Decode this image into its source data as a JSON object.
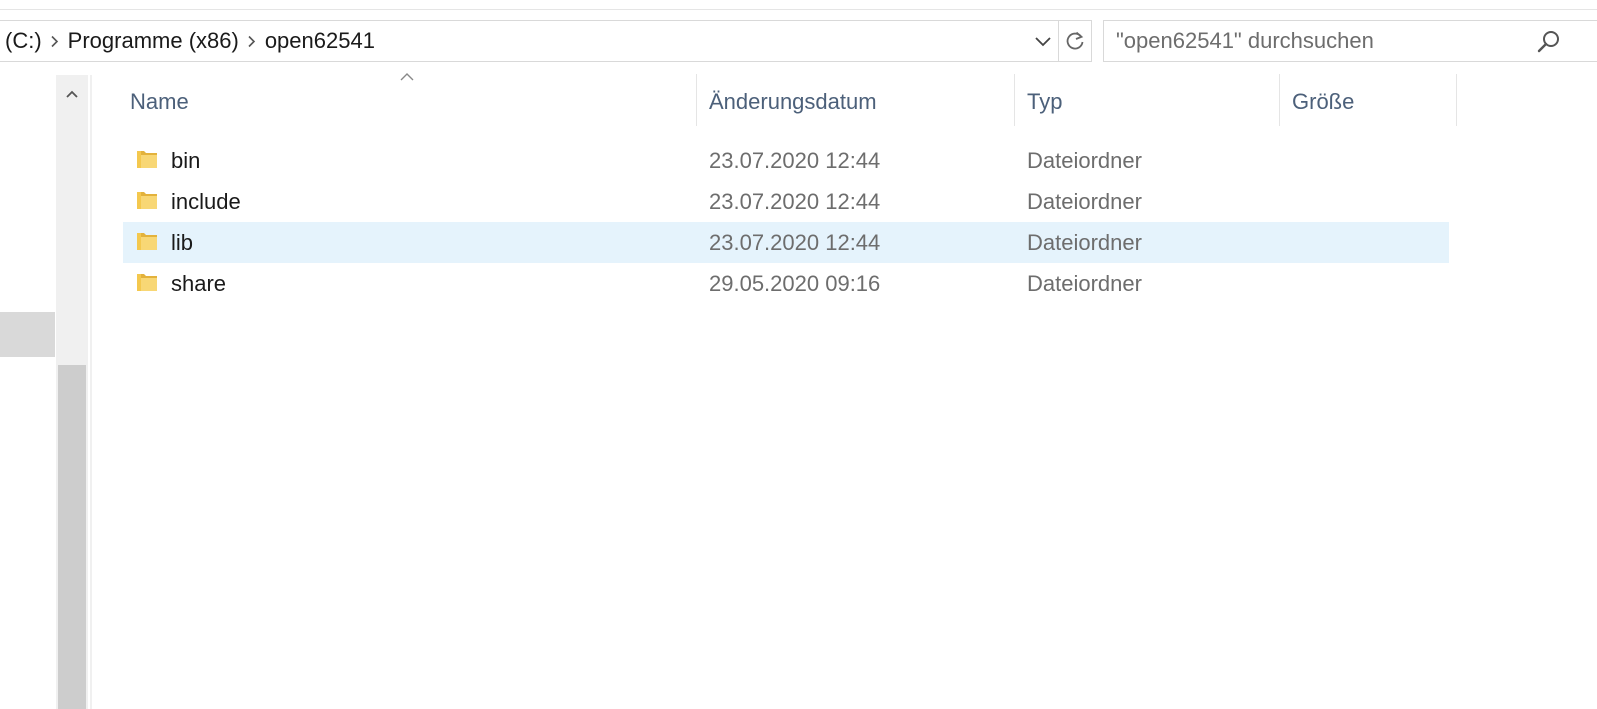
{
  "address": {
    "breadcrumbs": [
      "(C:)",
      "Programme (x86)",
      "open62541"
    ]
  },
  "search": {
    "placeholder": "\"open62541\" durchsuchen"
  },
  "columns": {
    "name": "Name",
    "date": "Änderungsdatum",
    "type": "Typ",
    "size": "Größe"
  },
  "files": [
    {
      "name": "bin",
      "date": "23.07.2020 12:44",
      "type": "Dateiordner",
      "size": ""
    },
    {
      "name": "include",
      "date": "23.07.2020 12:44",
      "type": "Dateiordner",
      "size": ""
    },
    {
      "name": "lib",
      "date": "23.07.2020 12:44",
      "type": "Dateiordner",
      "size": ""
    },
    {
      "name": "share",
      "date": "29.05.2020 09:16",
      "type": "Dateiordner",
      "size": ""
    }
  ],
  "selected_file": "lib",
  "sort": {
    "column": "name",
    "direction": "ascending"
  },
  "icons": {
    "breadcrumb_separator": "chevron-right-icon",
    "address_dropdown": "chevron-down-icon",
    "refresh": "refresh-icon",
    "search": "search-icon",
    "folder": "folder-icon",
    "scroll_up": "chevron-up-icon",
    "sort": "sort-ascending-icon"
  },
  "colors": {
    "selection": "#e5f3fc",
    "header_text": "#4c607a",
    "secondary_text": "#6d6d6d",
    "folder": "#f4c84e"
  }
}
